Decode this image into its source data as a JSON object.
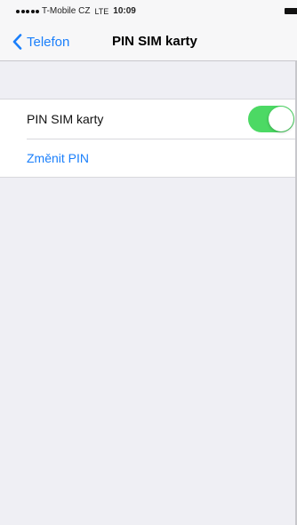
{
  "status_bar": {
    "signal_dots": 5,
    "carrier": "T-Mobile CZ",
    "network": "LTE",
    "time": "10:09"
  },
  "nav": {
    "back_label": "Telefon",
    "title": "PIN SIM karty"
  },
  "settings": {
    "pin_label": "PIN SIM karty",
    "pin_enabled": true,
    "change_pin_label": "Změnit PIN"
  },
  "colors": {
    "accent": "#1a7ffb",
    "toggle_on": "#4cd964",
    "background": "#efeff4"
  },
  "icons": {
    "back": "chevron-left-icon",
    "battery": "battery-icon"
  }
}
